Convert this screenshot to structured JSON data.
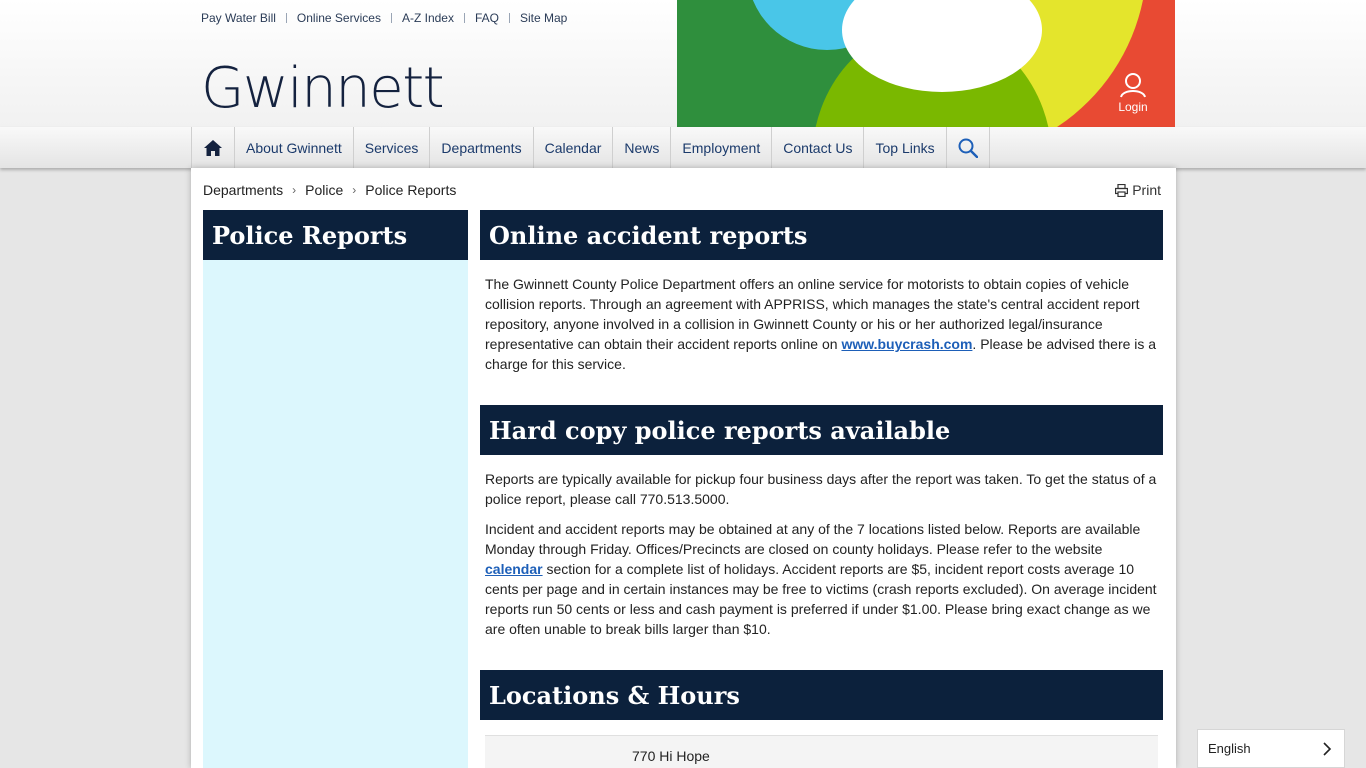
{
  "utility_links": [
    "Pay Water Bill",
    "Online Services",
    "A-Z Index",
    "FAQ",
    "Site Map"
  ],
  "logo_text": "Gwinnett",
  "login_label": "Login",
  "nav_items": [
    "About Gwinnett",
    "Services",
    "Departments",
    "Calendar",
    "News",
    "Employment",
    "Contact Us",
    "Top Links"
  ],
  "breadcrumb": [
    "Departments",
    "Police",
    "Police Reports"
  ],
  "print_label": "Print",
  "sidebar_title": "Police Reports",
  "sections": {
    "online": {
      "title": "Online accident reports",
      "p1_before": "The Gwinnett County Police Department offers an online service for motorists to obtain copies of vehicle collision reports. Through an agreement with  APPRISS, which manages the state's central accident report repository, anyone involved in a collision in Gwinnett County or his or her authorized legal/insurance representative can obtain their accident reports online on ",
      "p1_link": "www.buycrash.com",
      "p1_after": ". Please be advised there is a charge for this service."
    },
    "hard_copy": {
      "title": "Hard copy police reports available",
      "p1": "Reports are typically available for pickup four business days after the report was taken. To get the status of a police report, please call 770.513.5000.",
      "p2_before": "Incident and accident reports may be obtained at any of the 7 locations listed below.   Reports are available Monday through Friday. Offices/Precincts are closed on county holidays.  Please refer to the website ",
      "p2_link": "calendar",
      "p2_after": " section for a complete list of holidays.  Accident reports are $5, incident report costs average 10 cents per page and in certain instances may be free to victims (crash reports excluded).  On average incident reports run 50 cents or less and cash payment is preferred if under $1.00.   Please bring exact change as we are often unable to break bills larger than $10."
    },
    "locations": {
      "title": "Locations & Hours",
      "first_address": "770 Hi Hope"
    }
  },
  "language": "English",
  "colors": {
    "heading_bg": "#0c213c",
    "sidebar_bg": "#dcf7fd",
    "link": "#1d5fb8",
    "hero_green": "#2f8f3d",
    "hero_lime": "#7ab800",
    "hero_yellow": "#e4e52c",
    "hero_cyan": "#49c6e8",
    "hero_red": "#e84a33"
  }
}
